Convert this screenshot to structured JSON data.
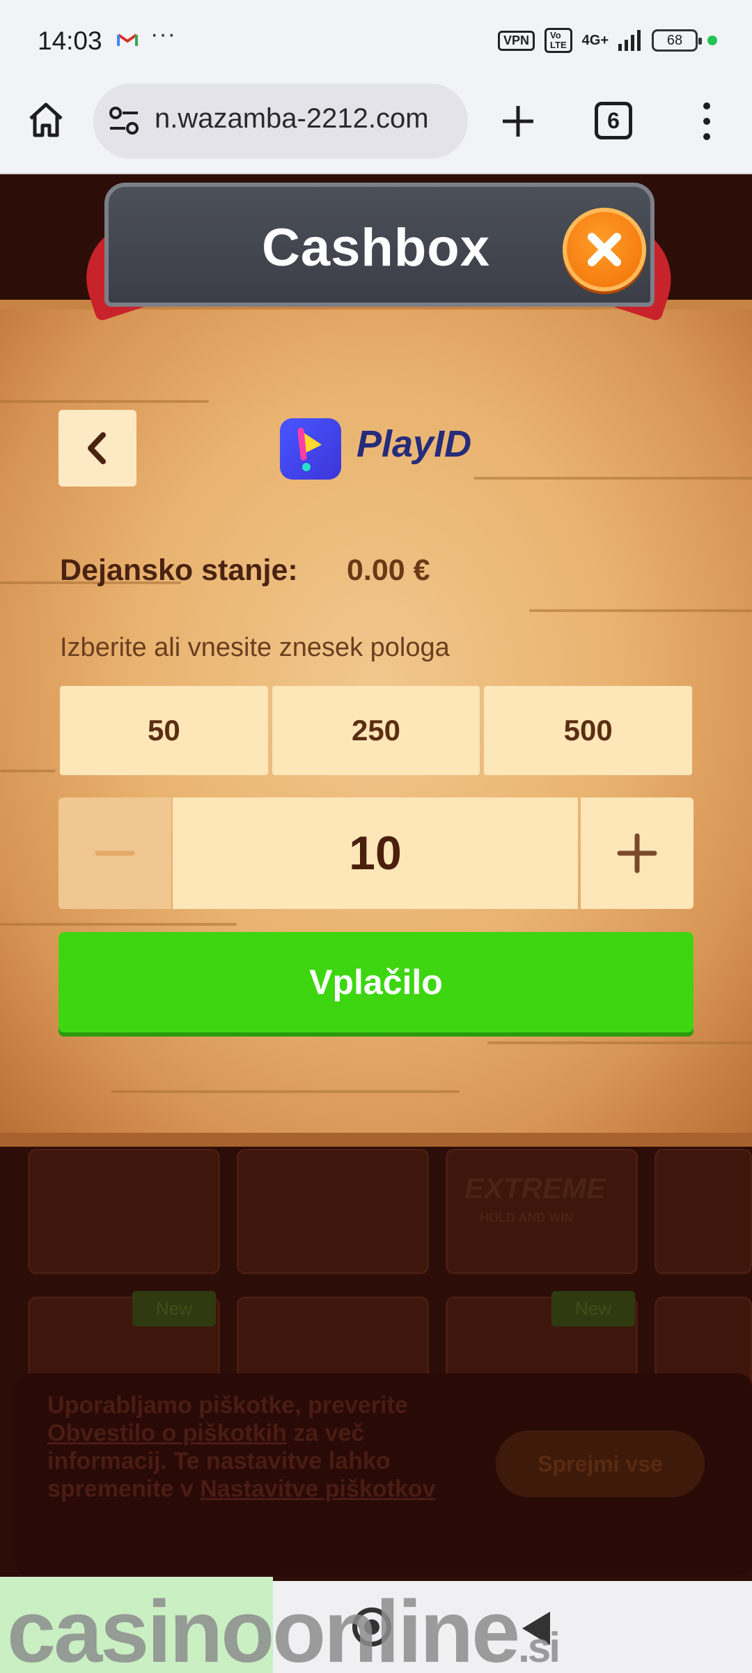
{
  "status_bar": {
    "time": "14:03",
    "more": "···",
    "vpn": "VPN",
    "volte": "VoLTE",
    "network": "4G+",
    "battery": "68"
  },
  "browser": {
    "url": "n.wazamba-2212.com",
    "tab_count": "6",
    "icons": [
      "home-icon",
      "site-settings-icon",
      "new-tab-icon",
      "tabs-icon",
      "menu-icon"
    ]
  },
  "modal": {
    "title": "Cashbox",
    "provider": "PlayID",
    "balance_label": "Dejansko stanje:",
    "balance_value": "0.00 €",
    "amount_prompt": "Izberite ali vnesite znesek pologa",
    "presets": [
      "50",
      "250",
      "500"
    ],
    "amount_value": "10",
    "deposit_label": "Vplačilo",
    "accent_color": "#3dd611",
    "close_color": "#f27006"
  },
  "cookie_banner": {
    "text_1": "Uporabljamo piškotke, preverite",
    "link_1": "Obvestilo o piškotkih",
    "text_2": "za več informacij. Te nastavitve lahko spremenite v",
    "link_2": "Nastavitve piškotkov",
    "accept_label": "Sprejmi vse"
  },
  "background_games": {
    "extreme_label": "EXTREME",
    "extreme_sub": "HOLD AND WIN",
    "new_badge": "New"
  },
  "watermark": {
    "text": "casinoonline",
    "suffix": ".si"
  }
}
